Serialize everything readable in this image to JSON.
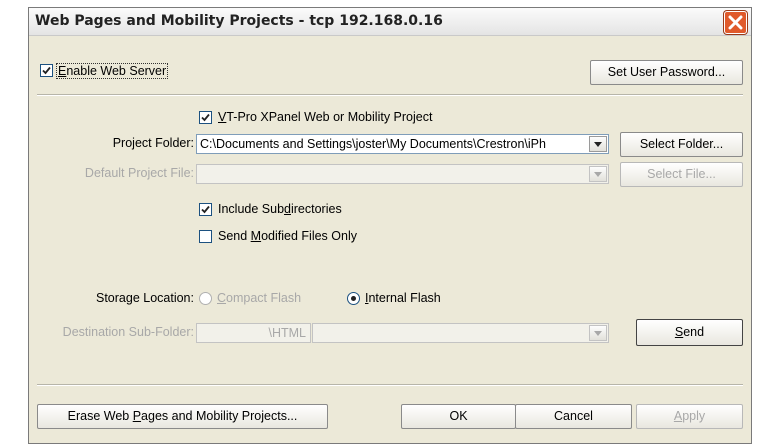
{
  "window": {
    "title": "Web Pages and Mobility Projects - tcp 192.168.0.16"
  },
  "enable_web_server": {
    "label_prefix": "",
    "mnemonic": "E",
    "label_rest": "nable Web Server",
    "checked": true
  },
  "set_user_password": {
    "label": "Set User Password..."
  },
  "vt_pro": {
    "mnemonic": "V",
    "label_rest": "T-Pro XPanel Web or Mobility Project",
    "checked": true
  },
  "project_folder": {
    "label": "Project Folder:",
    "value": "C:\\Documents and Settings\\joster\\My Documents\\Crestron\\iPh"
  },
  "select_folder": {
    "label": "Select Folder..."
  },
  "default_project_file": {
    "label": "Default Project File:",
    "value": ""
  },
  "select_file": {
    "label": "Select File..."
  },
  "include_subdirs": {
    "label_prefix": "Include Sub",
    "mnemonic": "d",
    "label_rest": "irectories",
    "checked": true
  },
  "send_modified": {
    "label_prefix": "Send ",
    "mnemonic": "M",
    "label_rest": "odified Files Only",
    "checked": false
  },
  "storage_location": {
    "label": "Storage Location:",
    "compact_flash": {
      "mnemonic": "C",
      "label_rest": "ompact Flash",
      "selected": false
    },
    "internal_flash": {
      "mnemonic": "I",
      "label_rest": "nternal Flash",
      "selected": true
    }
  },
  "destination_subfolder": {
    "label": "Destination Sub-Folder:",
    "prefix": "\\HTML",
    "value": ""
  },
  "send": {
    "mnemonic": "S",
    "label_rest": "end"
  },
  "erase": {
    "label_prefix": "Erase Web ",
    "mnemonic": "P",
    "label_rest": "ages and Mobility Projects..."
  },
  "ok": {
    "label": "OK"
  },
  "cancel": {
    "label": "Cancel"
  },
  "apply": {
    "mnemonic": "A",
    "label_rest": "pply"
  }
}
